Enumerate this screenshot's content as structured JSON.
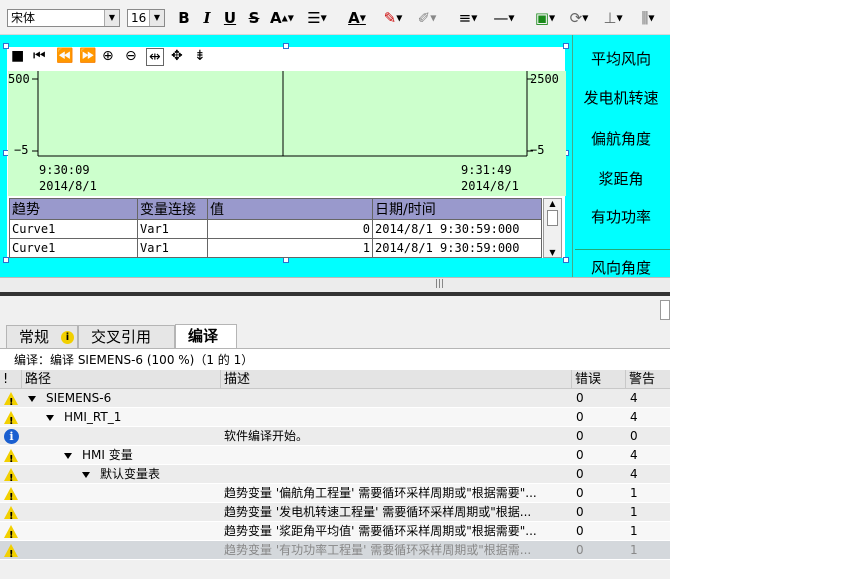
{
  "toolbar": {
    "font_name": "宋体",
    "font_size": "16",
    "bold": "B",
    "italic": "I",
    "underline": "U",
    "strike": "S",
    "font_color": "A",
    "icons": [
      "bold-icon",
      "italic-icon",
      "underline-icon",
      "strikethrough-icon",
      "font-size-icon",
      "align-icon",
      "font-color-icon",
      "fill-color-icon",
      "line-color-icon",
      "line-width-icon",
      "line-style-icon",
      "layer-icon",
      "rotate-icon",
      "align-objects-icon",
      "distribute-icon"
    ]
  },
  "trend": {
    "y_left_max": "500",
    "y_left_min": "−5",
    "y_right_max": "2500",
    "y_right_min": "−5",
    "x_start_time": "9:30:09",
    "x_start_date": "2014/8/1",
    "x_end_time": "9:31:49",
    "x_end_date": "2014/8/1",
    "table_headers": [
      "趋势",
      "变量连接",
      "值",
      "日期/时间"
    ],
    "table_rows": [
      {
        "trend": "Curve1",
        "tag": "Var1",
        "value": "0",
        "datetime": "2014/8/1  9:30:59:000"
      },
      {
        "trend": "Curve1",
        "tag": "Var1",
        "value": "1",
        "datetime": "2014/8/1  9:30:59:000"
      }
    ]
  },
  "right_labels": [
    "平均风向",
    "发电机转速",
    "偏航角度",
    "浆距角",
    "有功功率",
    "风向角度"
  ],
  "inspector": {
    "tabs": [
      "常规",
      "交叉引用",
      "编译"
    ],
    "summary": "编译：编译 SIEMENS-6 (100 %)（1 的 1）",
    "columns": {
      "flag": "!",
      "path": "路径",
      "desc": "描述",
      "errors": "错误",
      "warnings": "警告"
    },
    "rows": [
      {
        "icon": "warning",
        "indent": 0,
        "expand": true,
        "path": "SIEMENS-6",
        "desc": "",
        "errors": "0",
        "warnings": "4"
      },
      {
        "icon": "warning",
        "indent": 1,
        "expand": true,
        "path": "HMI_RT_1",
        "desc": "",
        "errors": "0",
        "warnings": "4"
      },
      {
        "icon": "info",
        "indent": 0,
        "expand": false,
        "path": "",
        "desc": "软件编译开始。",
        "errors": "0",
        "warnings": "0"
      },
      {
        "icon": "warning",
        "indent": 2,
        "expand": true,
        "path": "HMI 变量",
        "desc": "",
        "errors": "0",
        "warnings": "4"
      },
      {
        "icon": "warning",
        "indent": 3,
        "expand": true,
        "path": "默认变量表",
        "desc": "",
        "errors": "0",
        "warnings": "4"
      },
      {
        "icon": "warning",
        "indent": 0,
        "expand": false,
        "path": "",
        "desc": "趋势变量 '偏航角工程量' 需要循环采样周期或\"根据需要\"...",
        "errors": "0",
        "warnings": "1"
      },
      {
        "icon": "warning",
        "indent": 0,
        "expand": false,
        "path": "",
        "desc": "趋势变量 '发电机转速工程量' 需要循环采样周期或\"根据...",
        "errors": "0",
        "warnings": "1"
      },
      {
        "icon": "warning",
        "indent": 0,
        "expand": false,
        "path": "",
        "desc": "趋势变量 '浆距角平均值' 需要循环采样周期或\"根据需要\"...",
        "errors": "0",
        "warnings": "1"
      },
      {
        "icon": "warning",
        "indent": 0,
        "expand": false,
        "path": "",
        "desc": "趋势变量 '有功功率工程量' 需要循环采样周期或\"根据需...",
        "errors": "0",
        "warnings": "1",
        "selected": true
      }
    ]
  },
  "colors": {
    "canvas": "#00ffff",
    "plot": "#ccffcc",
    "table_header": "#9999cc",
    "warning": "#f2d000",
    "info": "#1a5fd0"
  }
}
